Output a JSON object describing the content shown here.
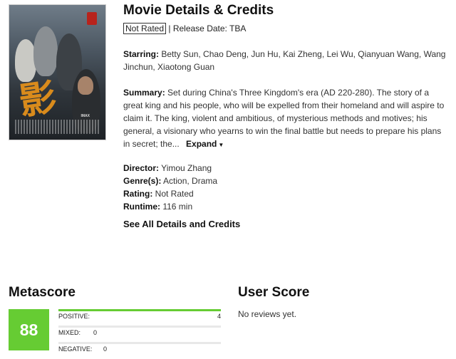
{
  "header": {
    "title": "Movie Details & Credits"
  },
  "meta": {
    "rating_badge": "Not Rated",
    "release": "| Release Date: TBA"
  },
  "starring": {
    "label": "Starring:",
    "value": "Betty Sun, Chao Deng, Jun Hu, Kai Zheng, Lei Wu, Qianyuan Wang, Wang Jinchun, Xiaotong Guan"
  },
  "summary": {
    "label": "Summary:",
    "text": "Set during China's Three Kingdom's era (AD 220-280). The story of a great king and his people, who will be expelled from their homeland and will aspire to claim it. The king, violent and ambitious, of mysterious methods and motives; his general, a visionary who yearns to win the final battle but needs to prepare his plans in secret; the...",
    "expand_label": "Expand",
    "expand_icon": "caret-down-icon"
  },
  "details": {
    "director_label": "Director:",
    "director": "Yimou Zhang",
    "genre_label": "Genre(s):",
    "genre": "Action, Drama",
    "rating_label": "Rating:",
    "rating": "Not Rated",
    "runtime_label": "Runtime:",
    "runtime": "116 min"
  },
  "see_all": "See All Details and Credits",
  "metascore": {
    "title": "Metascore",
    "score": "88",
    "score_color": "#66cc33",
    "distribution": [
      {
        "label": "POSITIVE:",
        "count": "4",
        "fraction": 1.0
      },
      {
        "label": "MIXED:",
        "count": "0",
        "fraction": 0
      },
      {
        "label": "NEGATIVE:",
        "count": "0",
        "fraction": 0
      }
    ]
  },
  "user_score": {
    "title": "User Score",
    "empty_text": "No reviews yet."
  },
  "poster": {
    "glyph": "影",
    "imax": "IMAX"
  }
}
